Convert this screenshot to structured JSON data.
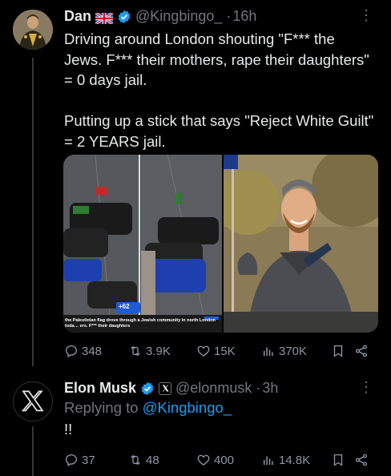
{
  "tweet": {
    "author_name": "Dan",
    "handle": "@Kingbingo_",
    "time": "16h",
    "text": "Driving around London shouting \"F*** the Jews. F*** their mothers, rape their daughters\" = 0 days jail.\n\nPutting up a stick that says \"Reject White Guilt\" = 2 YEARS jail.",
    "media_caption": "the Palestinian flag drove through a Jewish community in north London toda… ers. F*** their daughters",
    "media_badge": "+62",
    "stats": {
      "replies": "348",
      "reposts": "3.9K",
      "likes": "15K",
      "views": "370K"
    }
  },
  "reply": {
    "author_name": "Elon Musk",
    "handle": "@elonmusk",
    "time": "3h",
    "replying_label": "Replying to ",
    "replying_handle": "@Kingbingo_",
    "text": "!!",
    "stats": {
      "replies": "37",
      "reposts": "48",
      "likes": "400",
      "views": "14.8K"
    }
  },
  "colors": {
    "accent": "#1d9bf0",
    "muted": "#71767b",
    "text": "#e7e9ea",
    "background": "#000000"
  }
}
